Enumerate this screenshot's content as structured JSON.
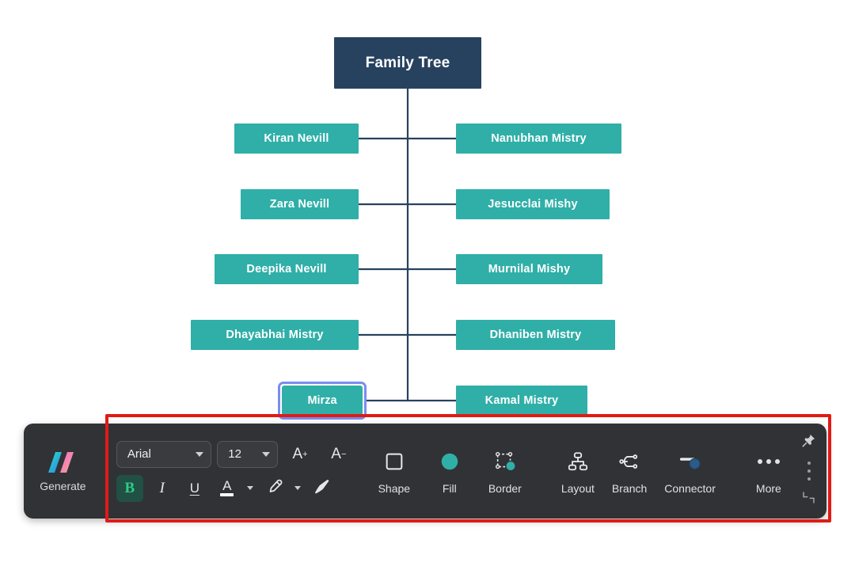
{
  "diagram": {
    "root": {
      "label": "Family Tree",
      "color": "#27425f"
    },
    "node_color": "#2fafa8",
    "selection_color": "#7b8cf0",
    "edge_color": "#27425f",
    "rows": [
      {
        "left": "Kiran Nevill",
        "right": "Nanubhan Mistry"
      },
      {
        "left": "Zara Nevill",
        "right": "Jesucclai Mishy"
      },
      {
        "left": "Deepika Nevill",
        "right": "Murnilal Mishy"
      },
      {
        "left": "Dhayabhai Mistry",
        "right": "Dhaniben Mistry"
      },
      {
        "left": "Mirza",
        "right": "Kamal Mistry",
        "selected": "left"
      }
    ]
  },
  "highlight": {
    "color": "#e01b16"
  },
  "toolbar": {
    "generate": {
      "label": "Generate",
      "icon": "sparkle-m-icon"
    },
    "font": {
      "family_value": "Arial",
      "size_value": "12",
      "increase_label": "A",
      "increase_sup": "+",
      "decrease_label": "A",
      "decrease_sup": "−"
    },
    "format": {
      "bold_label": "B",
      "bold_active": true,
      "italic_label": "I",
      "underline_label": "U",
      "font_color_label": "A",
      "font_color_swatch": "#ffffff",
      "highlight_icon": "highlighter-pen-icon",
      "painter_icon": "format-painter-icon"
    },
    "shape_tools": [
      {
        "label": "Shape",
        "icon": "square-outline-icon"
      },
      {
        "label": "Fill",
        "icon": "fill-circle-icon"
      },
      {
        "label": "Border",
        "icon": "border-box-icon"
      }
    ],
    "layout_tools": [
      {
        "label": "Layout",
        "icon": "hierarchy-layout-icon"
      },
      {
        "label": "Branch",
        "icon": "branch-node-icon"
      },
      {
        "label": "Connector",
        "icon": "connector-line-icon"
      }
    ],
    "more": {
      "label": "More",
      "icon": "ellipsis-icon"
    },
    "edge": {
      "pin_icon": "pin-icon",
      "drag_icon": "drag-dots-icon",
      "resize_icon": "resize-corner-icon"
    },
    "accent_active_bg": "#215044",
    "accent_active_fg": "#2ecc87",
    "panel_bg": "#313235"
  }
}
